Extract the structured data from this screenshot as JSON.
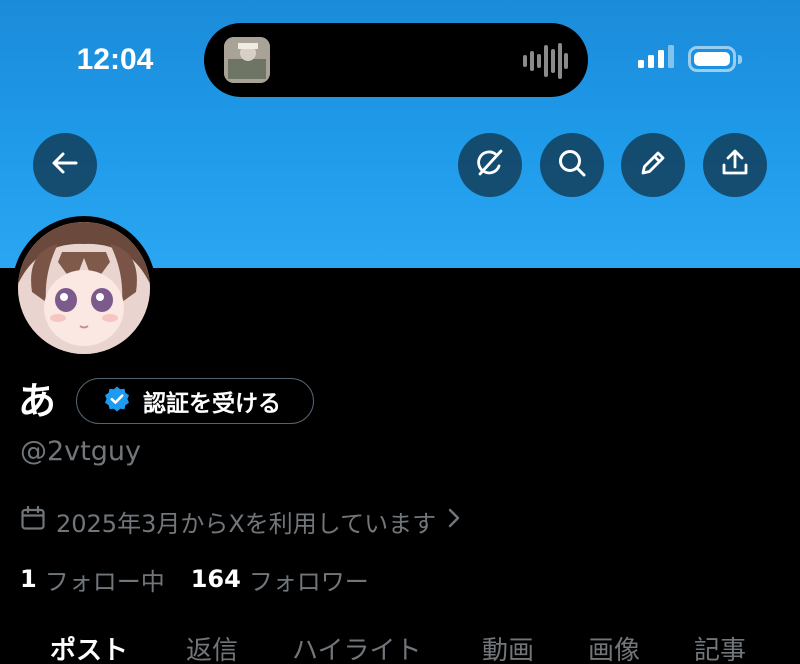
{
  "status_bar": {
    "time": "12:04",
    "icons": [
      "now-playing-thumbnail",
      "audio-waveform-icon",
      "cellular-signal-icon",
      "battery-icon"
    ]
  },
  "header": {
    "buttons": [
      "back-arrow-icon",
      "grok-icon",
      "search-icon",
      "edit-pencil-icon",
      "share-upload-icon"
    ],
    "banner_color": "#1f9bea"
  },
  "profile": {
    "display_name": "あ",
    "verify_button_label": "認証を受ける",
    "handle": "@2vtguy",
    "joined": "2025年3月からXを利用しています",
    "following_count": "1",
    "following_label": "フォロー中",
    "followers_count": "164",
    "followers_label": "フォロワー"
  },
  "tabs": [
    {
      "label": "ポスト",
      "active": true
    },
    {
      "label": "返信",
      "active": false
    },
    {
      "label": "ハイライト",
      "active": false
    },
    {
      "label": "動画",
      "active": false
    },
    {
      "label": "画像",
      "active": false
    },
    {
      "label": "記事",
      "active": false
    }
  ],
  "colors": {
    "accent": "#1d9bf0",
    "background": "#000000",
    "secondary_text": "#71767b"
  }
}
